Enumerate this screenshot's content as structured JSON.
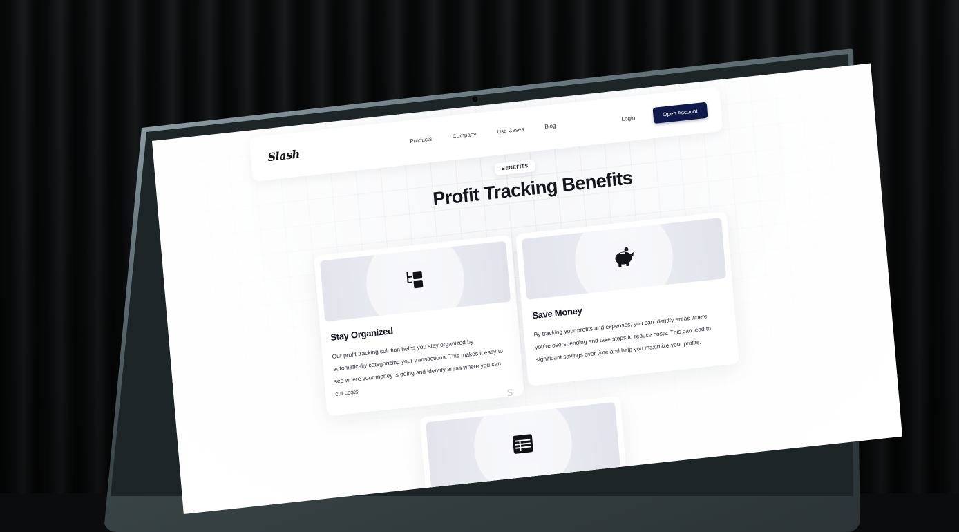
{
  "nav": {
    "logo": "Slash",
    "links": [
      "Products",
      "Company",
      "Use Cases",
      "Blog"
    ],
    "login": "Login",
    "cta": "Open Account"
  },
  "hero": {
    "badge": "BENEFITS",
    "title": "Profit Tracking Benefits"
  },
  "cards": [
    {
      "icon": "organize-icon",
      "title": "Stay Organized",
      "body": "Our profit-tracking solution helps you stay organized by automatically categorizing your transactions. This makes it easy to see where your money is going and identify areas where you can cut costs."
    },
    {
      "icon": "piggy-bank-icon",
      "title": "Save Money",
      "body": "By tracking your profits and expenses, you can identify areas where you're overspending and take steps to reduce costs. This can lead to significant savings over time and help you maximize your profits."
    },
    {
      "icon": "table-icon",
      "title": "",
      "body": ""
    }
  ],
  "divider_glyph": "S"
}
